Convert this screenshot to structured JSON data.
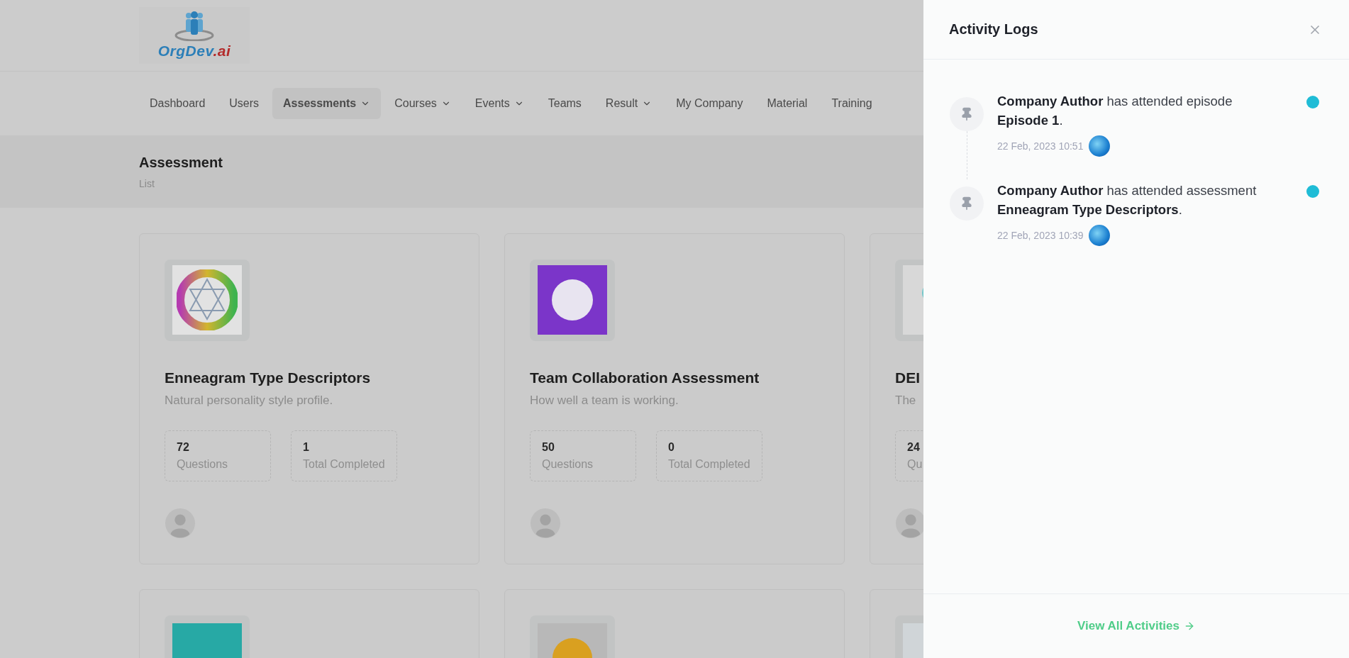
{
  "logo": {
    "main": "OrgDev",
    "suffix": ".ai"
  },
  "nav": {
    "items": [
      {
        "label": "Dashboard",
        "dropdown": false,
        "selected": false
      },
      {
        "label": "Users",
        "dropdown": false,
        "selected": false
      },
      {
        "label": "Assessments",
        "dropdown": true,
        "selected": true
      },
      {
        "label": "Courses",
        "dropdown": true,
        "selected": false
      },
      {
        "label": "Events",
        "dropdown": true,
        "selected": false
      },
      {
        "label": "Teams",
        "dropdown": false,
        "selected": false
      },
      {
        "label": "Result",
        "dropdown": true,
        "selected": false
      },
      {
        "label": "My Company",
        "dropdown": false,
        "selected": false
      },
      {
        "label": "Material",
        "dropdown": false,
        "selected": false
      },
      {
        "label": "Training",
        "dropdown": false,
        "selected": false
      }
    ]
  },
  "page_header": {
    "title": "Assessment",
    "subtitle": "List"
  },
  "cards": [
    {
      "kind": "enneagram",
      "title": "Enneagram Type Descriptors",
      "description": "Natural personality style profile.",
      "stats": [
        {
          "value": "72",
          "label": "Questions"
        },
        {
          "value": "1",
          "label": "Total Completed"
        }
      ]
    },
    {
      "kind": "team",
      "title": "Team Collaboration Assessment",
      "description": "How well a team is working.",
      "stats": [
        {
          "value": "50",
          "label": "Questions"
        },
        {
          "value": "0",
          "label": "Total Completed"
        }
      ]
    },
    {
      "kind": "bubbles",
      "title": "DEI",
      "description": "The",
      "stats": [
        {
          "value": "24",
          "label": "Qu"
        }
      ]
    }
  ],
  "more_cards": [
    {
      "kind": "crowd"
    },
    {
      "kind": "change"
    },
    {
      "kind": "person"
    }
  ],
  "activity": {
    "title": "Activity Logs",
    "items": [
      {
        "text": "**Company Author** has attended episode **Episode 1**.",
        "time": "22 Feb, 2023 10:51",
        "color": "#1fbcd6"
      },
      {
        "text": "**Company Author** has attended assessment **Enneagram Type Descriptors**.",
        "time": "22 Feb, 2023 10:39",
        "color": "#1fbcd6"
      }
    ],
    "footer_link": "View All Activities"
  }
}
